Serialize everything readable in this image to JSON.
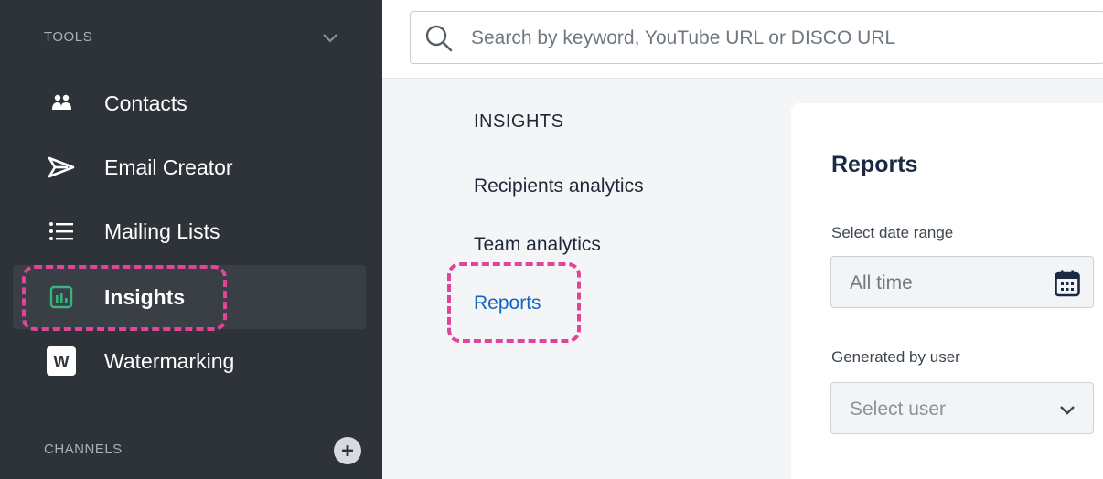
{
  "sidebar": {
    "tools_header": "TOOLS",
    "items": [
      {
        "label": "Contacts",
        "icon": "contacts-icon"
      },
      {
        "label": "Email Creator",
        "icon": "send-icon"
      },
      {
        "label": "Mailing Lists",
        "icon": "list-icon"
      },
      {
        "label": "Insights",
        "icon": "insights-icon",
        "active": true
      },
      {
        "label": "Watermarking",
        "icon": "watermark-icon"
      }
    ],
    "channels_header": "CHANNELS"
  },
  "search": {
    "placeholder": "Search by keyword, YouTube URL or DISCO URL"
  },
  "subnav": {
    "title": "INSIGHTS",
    "items": [
      {
        "label": "Recipients analytics"
      },
      {
        "label": "Team analytics"
      },
      {
        "label": "Reports",
        "active": true
      }
    ]
  },
  "reports_card": {
    "title": "Reports",
    "date_range_label": "Select date range",
    "date_range_value": "All time",
    "user_label": "Generated by user",
    "user_placeholder": "Select user"
  },
  "colors": {
    "sidebar_bg": "#2d3339",
    "accent_link": "#1565c0",
    "highlight": "#e2449a",
    "insights_icon": "#37b37e"
  }
}
